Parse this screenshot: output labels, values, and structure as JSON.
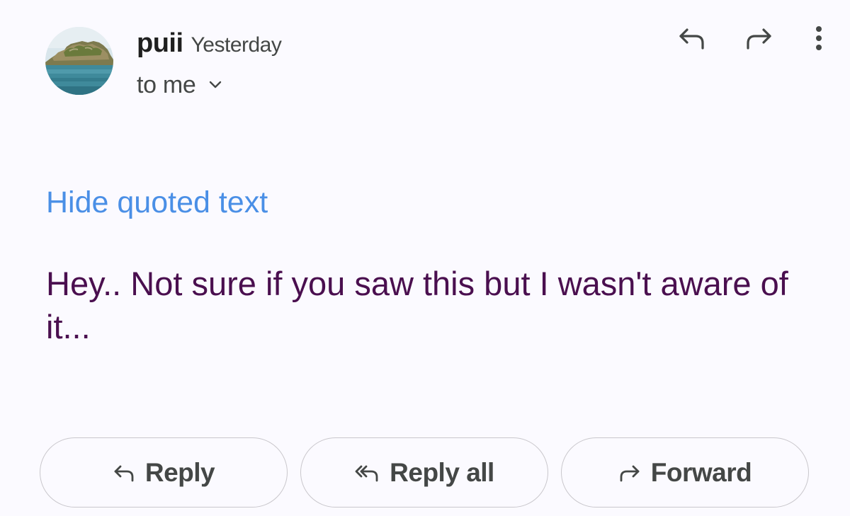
{
  "sender": {
    "name": "puii",
    "time": "Yesterday",
    "recipient": "to me",
    "avatar_icon": "landscape-photo-avatar"
  },
  "toolbar": {
    "reply_icon": "reply-icon",
    "forward_icon": "forward-icon",
    "more_icon": "more-vert-icon"
  },
  "message": {
    "quoted_toggle": "Hide quoted text",
    "body": "Hey.. Not sure if you saw this but I wasn't aware of it..."
  },
  "actions": {
    "reply_label": "Reply",
    "reply_all_label": "Reply all",
    "forward_label": "Forward"
  },
  "colors": {
    "background": "#fbfaff",
    "link": "#4a8fe6",
    "body_text": "#4a0f4f",
    "icon": "#444746",
    "pill_border": "#c9c7cc"
  }
}
